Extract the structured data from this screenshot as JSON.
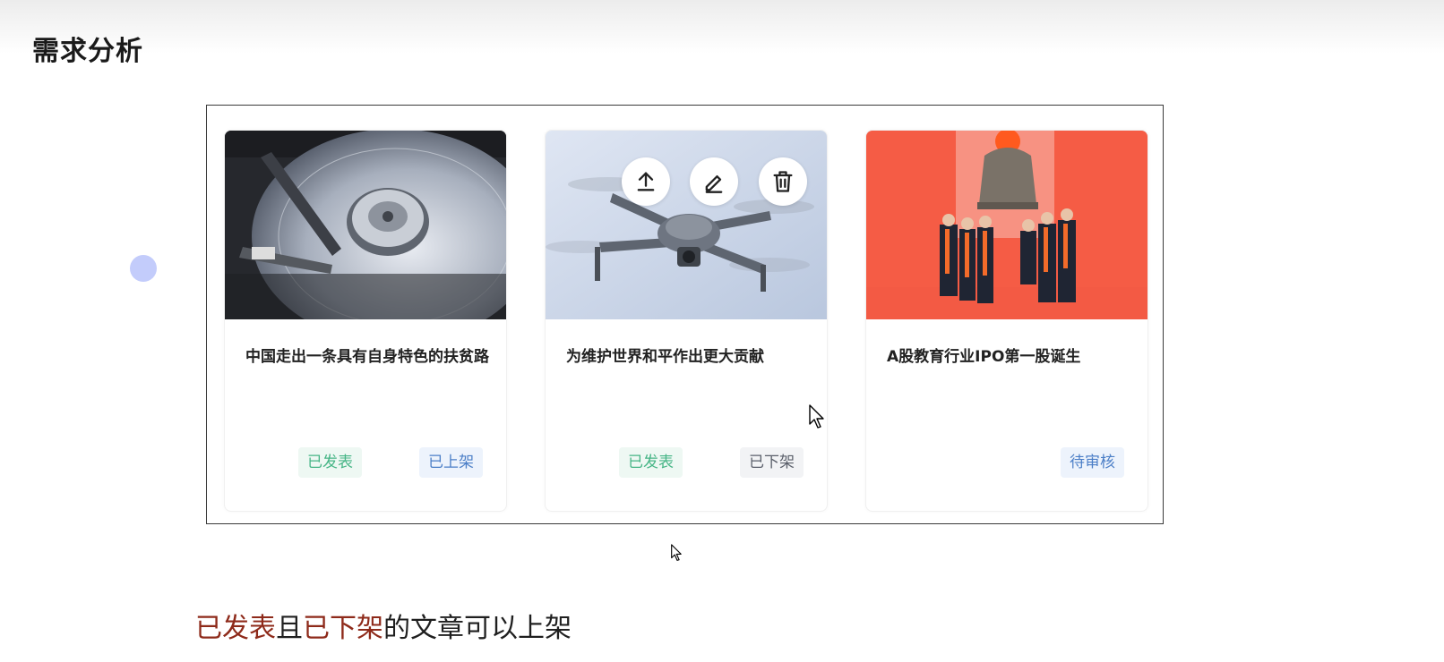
{
  "page_title": "需求分析",
  "cards": [
    {
      "title": "中国走出一条具有自身特色的扶贫路",
      "tags": [
        {
          "label": "已发表",
          "color": "#46b586"
        },
        {
          "label": "已上架",
          "color": "#4c7fc7"
        }
      ],
      "image": "hard-disk-photo"
    },
    {
      "title": "为维护世界和平作出更大贡献",
      "tags": [
        {
          "label": "已发表",
          "color": "#46b586"
        },
        {
          "label": "已下架",
          "color": "#5a5f6a"
        }
      ],
      "image": "drone-photo",
      "actions": [
        {
          "icon": "upload-icon"
        },
        {
          "icon": "edit-icon"
        },
        {
          "icon": "trash-icon"
        }
      ]
    },
    {
      "title": "A股教育行业IPO第一股诞生",
      "tags": [
        {
          "label": "待审核",
          "color": "#4c7fc7"
        }
      ],
      "image": "bell-ringing-ceremony-photo"
    }
  ],
  "note": {
    "part1": "已发表",
    "part2": "且",
    "part3": "已下架",
    "part4": "的文章可以上架",
    "highlight_color": "#8e2a1a"
  }
}
